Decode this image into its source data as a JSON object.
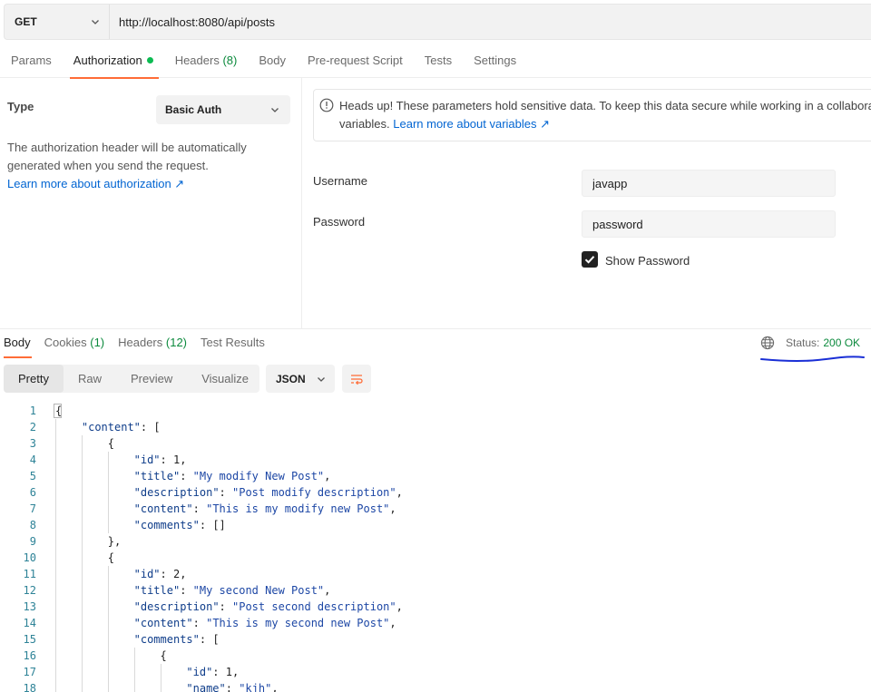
{
  "request": {
    "method": "GET",
    "url": "http://localhost:8080/api/posts"
  },
  "request_tabs": [
    {
      "label": "Params",
      "count": "",
      "active": false
    },
    {
      "label": "Authorization",
      "count": "",
      "active": true,
      "dot": true
    },
    {
      "label": "Headers",
      "count": "(8)",
      "active": false
    },
    {
      "label": "Body",
      "count": "",
      "active": false
    },
    {
      "label": "Pre-request Script",
      "count": "",
      "active": false
    },
    {
      "label": "Tests",
      "count": "",
      "active": false
    },
    {
      "label": "Settings",
      "count": "",
      "active": false
    }
  ],
  "auth": {
    "type_label": "Type",
    "type_value": "Basic Auth",
    "description": "The authorization header will be automatically generated when you send the request.",
    "learn_link": "Learn more about authorization ↗",
    "notice_line1": "Heads up! These parameters hold sensitive data. To keep this data secure while working in a collaborati",
    "notice_line2_prefix": "variables. ",
    "notice_link": "Learn more about variables ↗",
    "username_label": "Username",
    "username_value": "javapp",
    "password_label": "Password",
    "password_value": "password",
    "show_password_label": "Show Password",
    "show_password_checked": true
  },
  "response_tabs": [
    {
      "label": "Body",
      "count": "",
      "active": true
    },
    {
      "label": "Cookies",
      "count": "(1)",
      "active": false
    },
    {
      "label": "Headers",
      "count": "(12)",
      "active": false
    },
    {
      "label": "Test Results",
      "count": "",
      "active": false
    }
  ],
  "status": {
    "label": "Status:",
    "code": "200 OK"
  },
  "format_tabs": [
    {
      "label": "Pretty",
      "active": true
    },
    {
      "label": "Raw",
      "active": false
    },
    {
      "label": "Preview",
      "active": false
    },
    {
      "label": "Visualize",
      "active": false
    }
  ],
  "format_select": "JSON",
  "code_lines": [
    {
      "n": "1",
      "indent": 0,
      "parts": [
        [
          "p",
          "{"
        ]
      ]
    },
    {
      "n": "2",
      "indent": 1,
      "parts": [
        [
          "k",
          "\"content\""
        ],
        [
          "p",
          ": ["
        ]
      ]
    },
    {
      "n": "3",
      "indent": 2,
      "parts": [
        [
          "p",
          "{"
        ]
      ]
    },
    {
      "n": "4",
      "indent": 3,
      "parts": [
        [
          "k",
          "\"id\""
        ],
        [
          "p",
          ": "
        ],
        [
          "n",
          "1"
        ],
        [
          "p",
          ","
        ]
      ]
    },
    {
      "n": "5",
      "indent": 3,
      "parts": [
        [
          "k",
          "\"title\""
        ],
        [
          "p",
          ": "
        ],
        [
          "s",
          "\"My modify New Post\""
        ],
        [
          "p",
          ","
        ]
      ]
    },
    {
      "n": "6",
      "indent": 3,
      "parts": [
        [
          "k",
          "\"description\""
        ],
        [
          "p",
          ": "
        ],
        [
          "s",
          "\"Post modify description\""
        ],
        [
          "p",
          ","
        ]
      ]
    },
    {
      "n": "7",
      "indent": 3,
      "parts": [
        [
          "k",
          "\"content\""
        ],
        [
          "p",
          ": "
        ],
        [
          "s",
          "\"This is my modify new Post\""
        ],
        [
          "p",
          ","
        ]
      ]
    },
    {
      "n": "8",
      "indent": 3,
      "parts": [
        [
          "k",
          "\"comments\""
        ],
        [
          "p",
          ": []"
        ]
      ]
    },
    {
      "n": "9",
      "indent": 2,
      "parts": [
        [
          "p",
          "},"
        ]
      ]
    },
    {
      "n": "10",
      "indent": 2,
      "parts": [
        [
          "p",
          "{"
        ]
      ]
    },
    {
      "n": "11",
      "indent": 3,
      "parts": [
        [
          "k",
          "\"id\""
        ],
        [
          "p",
          ": "
        ],
        [
          "n",
          "2"
        ],
        [
          "p",
          ","
        ]
      ]
    },
    {
      "n": "12",
      "indent": 3,
      "parts": [
        [
          "k",
          "\"title\""
        ],
        [
          "p",
          ": "
        ],
        [
          "s",
          "\"My second New Post\""
        ],
        [
          "p",
          ","
        ]
      ]
    },
    {
      "n": "13",
      "indent": 3,
      "parts": [
        [
          "k",
          "\"description\""
        ],
        [
          "p",
          ": "
        ],
        [
          "s",
          "\"Post second description\""
        ],
        [
          "p",
          ","
        ]
      ]
    },
    {
      "n": "14",
      "indent": 3,
      "parts": [
        [
          "k",
          "\"content\""
        ],
        [
          "p",
          ": "
        ],
        [
          "s",
          "\"This is my second new Post\""
        ],
        [
          "p",
          ","
        ]
      ]
    },
    {
      "n": "15",
      "indent": 3,
      "parts": [
        [
          "k",
          "\"comments\""
        ],
        [
          "p",
          ": ["
        ]
      ]
    },
    {
      "n": "16",
      "indent": 4,
      "parts": [
        [
          "p",
          "{"
        ]
      ]
    },
    {
      "n": "17",
      "indent": 5,
      "parts": [
        [
          "k",
          "\"id\""
        ],
        [
          "p",
          ": "
        ],
        [
          "n",
          "1"
        ],
        [
          "p",
          ","
        ]
      ]
    },
    {
      "n": "18",
      "indent": 5,
      "parts": [
        [
          "k",
          "\"name\""
        ],
        [
          "p",
          ": "
        ],
        [
          "s",
          "\"kjh\""
        ],
        [
          "p",
          ","
        ]
      ]
    }
  ],
  "colors": {
    "accent": "#ff6c37",
    "success": "#0c8a3d",
    "link": "#0265d2",
    "annotation": "#1a2fd6"
  },
  "icons": [
    "chevron-down-icon",
    "info-icon",
    "checkmark-icon",
    "globe-icon",
    "wrap-lines-icon"
  ]
}
